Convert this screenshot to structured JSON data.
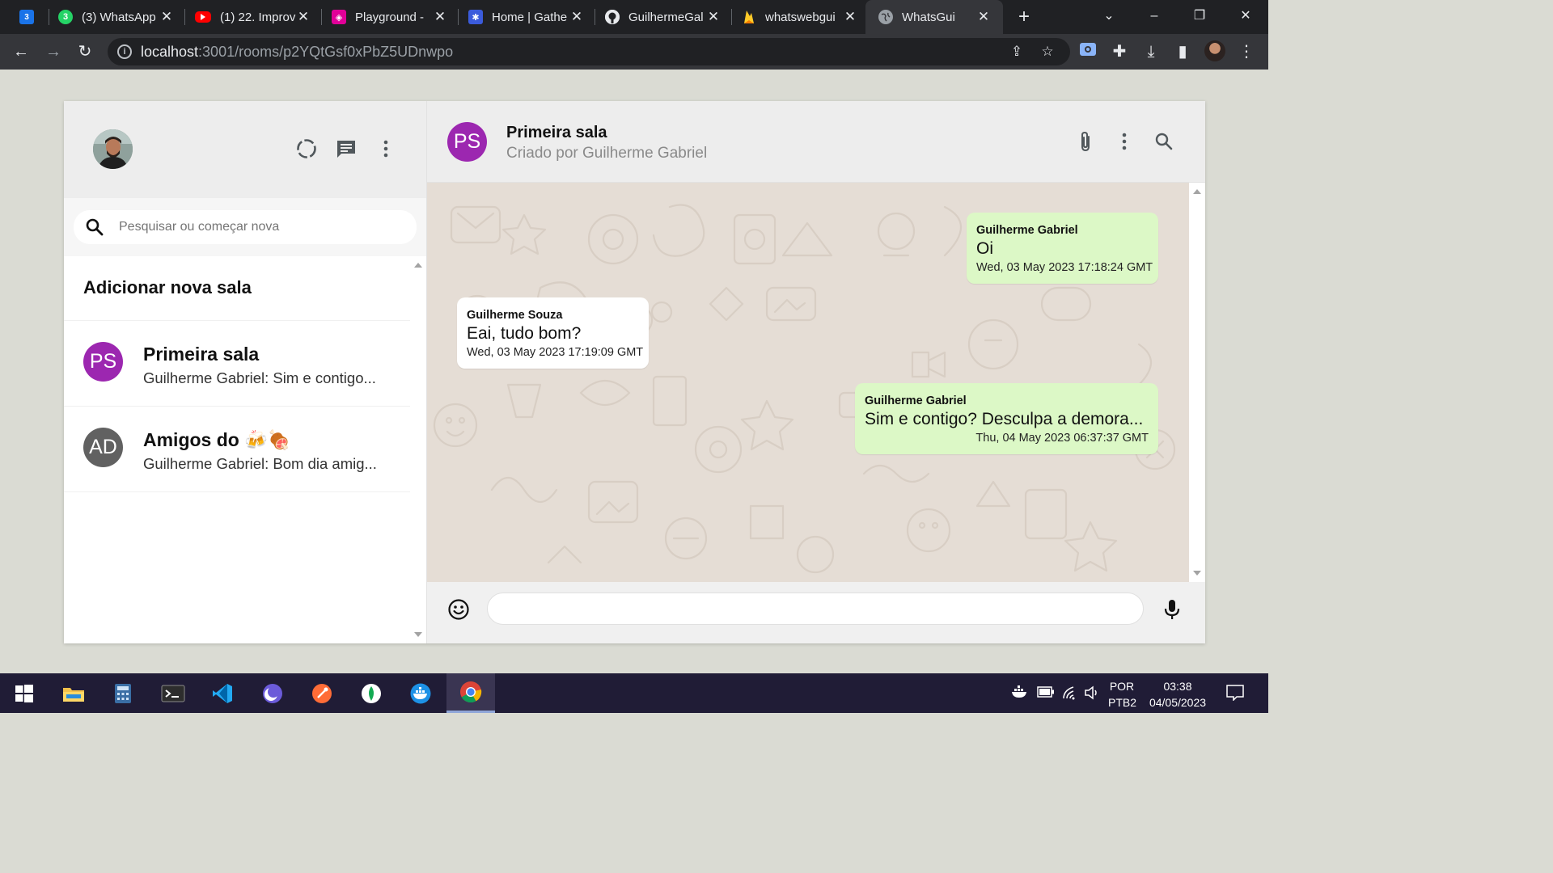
{
  "browser": {
    "tabs": [
      {
        "title": "",
        "favicon": "calendar-icon",
        "badge": "3",
        "color": "#1a73e8"
      },
      {
        "title": "(3) WhatsApp",
        "favicon": "whatsapp-icon",
        "badge": "3",
        "color": "#25d366"
      },
      {
        "title": "(1) 22. Improv",
        "favicon": "youtube-icon",
        "badge": "",
        "color": "#ff0000"
      },
      {
        "title": "Playground - ",
        "favicon": "graphql-icon",
        "badge": "",
        "color": "#e10098"
      },
      {
        "title": "Home | Gathe",
        "favicon": "gather-icon",
        "badge": "",
        "color": "#3b5bdb"
      },
      {
        "title": "GuilhermeGal",
        "favicon": "github-icon",
        "badge": "",
        "color": "#e8eaed"
      },
      {
        "title": "whatswebgui",
        "favicon": "firebase-icon",
        "badge": "",
        "color": "#ffca28"
      },
      {
        "title": "WhatsGui",
        "favicon": "globe-icon",
        "badge": "",
        "color": "#9aa0a6"
      }
    ],
    "url_host": "localhost",
    "url_path": ":3001/rooms/p2YQtGsf0xPbZ5UDnwpo"
  },
  "sidebar": {
    "search_placeholder": "Pesquisar ou começar nova conversa",
    "add_room_label": "Adicionar nova sala",
    "rooms": [
      {
        "initials": "PS",
        "name": "Primeira sala",
        "last_message": "Guilherme Gabriel: Sim e contigo...",
        "color": "#9c27b0"
      },
      {
        "initials": "AD",
        "name": "Amigos do 🍻🍖",
        "last_message": "Guilherme Gabriel: Bom dia amig...",
        "color": "#616161"
      }
    ]
  },
  "chat": {
    "initials": "PS",
    "title": "Primeira sala",
    "subtitle": "Criado por Guilherme Gabriel",
    "messages": [
      {
        "author": "Guilherme Gabriel",
        "text": "Oi",
        "timestamp": "Wed, 03 May 2023 17:18:24 GMT",
        "sent": true
      },
      {
        "author": "Guilherme Souza",
        "text": "Eai, tudo bom?",
        "timestamp": "Wed, 03 May 2023 17:19:09 GMT",
        "sent": false
      },
      {
        "author": "Guilherme Gabriel",
        "text": "Sim e contigo? Desculpa a demora...",
        "timestamp": "Thu, 04 May 2023 06:37:37 GMT",
        "sent": true
      }
    ],
    "composer_value": ""
  },
  "taskbar": {
    "lang_top": "POR",
    "lang_bottom": "PTB2",
    "time": "03:38",
    "date": "04/05/2023"
  },
  "colors": {
    "sent_bubble": "#dcf8c6",
    "received_bubble": "#ffffff",
    "chat_background": "#e5ddd5",
    "header_gray": "#ededed"
  }
}
